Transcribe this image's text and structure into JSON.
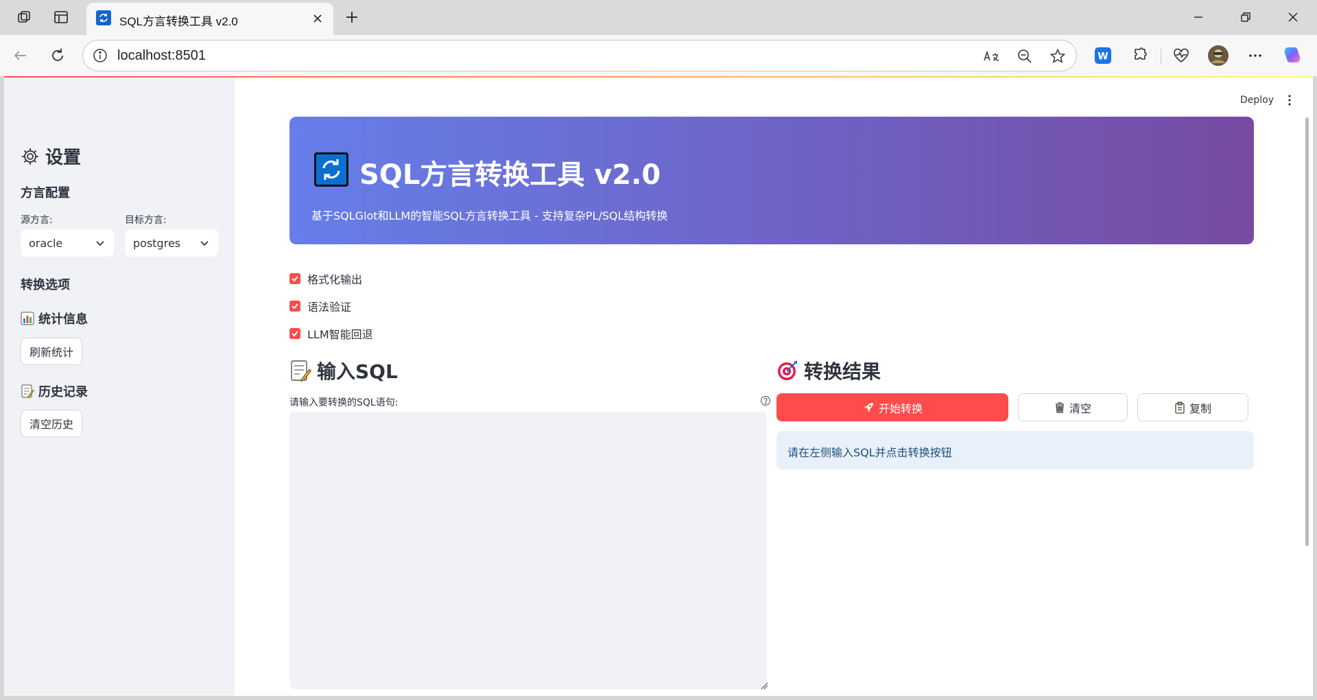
{
  "browser": {
    "tab_title": "SQL方言转换工具 v2.0",
    "url": "localhost:8501"
  },
  "app": {
    "deploy_label": "Deploy",
    "banner": {
      "title": "SQL方言转换工具 v2.0",
      "subtitle": "基于SQLGlot和LLM的智能SQL方言转换工具 - 支持复杂PL/SQL结构转换"
    },
    "sidebar": {
      "title": "设置",
      "dialect_section": "方言配置",
      "source_label": "源方言:",
      "source_value": "oracle",
      "target_label": "目标方言:",
      "target_value": "postgres",
      "options_section": "转换选项",
      "stats_section": "统计信息",
      "refresh_stats": "刷新统计",
      "history_section": "历史记录",
      "clear_history": "清空历史"
    },
    "options": [
      {
        "label": "格式化输出",
        "checked": true
      },
      {
        "label": "语法验证",
        "checked": true
      },
      {
        "label": "LLM智能回退",
        "checked": true
      }
    ],
    "input": {
      "heading": "输入SQL",
      "textarea_label": "请输入要转换的SQL语句:",
      "value": ""
    },
    "result": {
      "heading": "转换结果",
      "convert_button": "开始转换",
      "clear_button": "清空",
      "copy_button": "复制",
      "info": "请在左侧输入SQL并点击转换按钮"
    },
    "colors": {
      "primary": "#ff4b4b",
      "banner_start": "#667eea",
      "banner_end": "#764ba2",
      "sidebar_bg": "#f0f2f6",
      "info_bg": "#e8f1fb",
      "info_text": "#1e4e7c"
    }
  }
}
